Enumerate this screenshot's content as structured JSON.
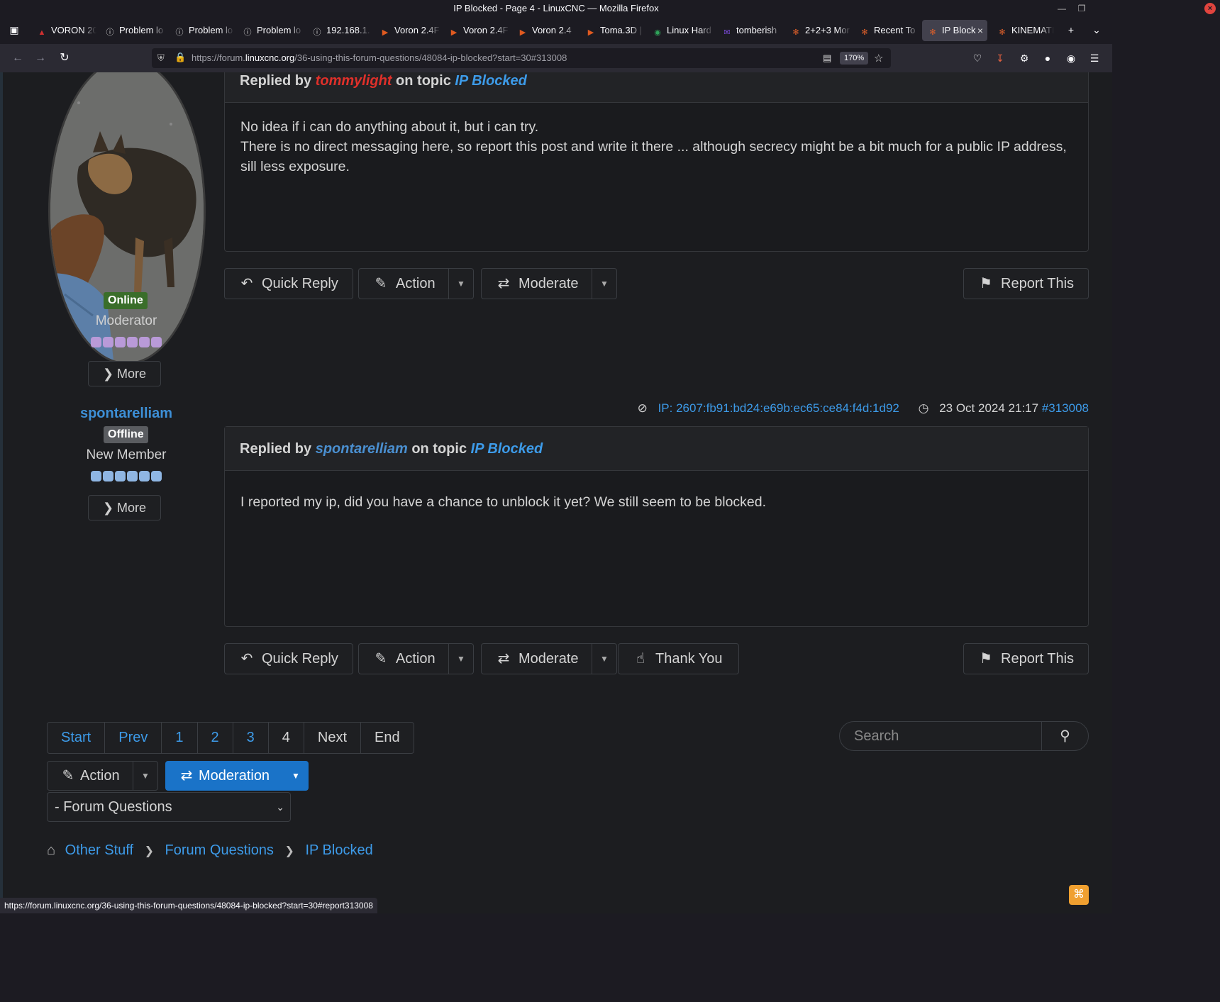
{
  "window": {
    "title": "IP Blocked - Page 4 - LinuxCNC — Mozilla Firefox"
  },
  "tabs": [
    {
      "label": "VORON 20",
      "icon": "voron-icon"
    },
    {
      "label": "Problem lo",
      "icon": "info-icon"
    },
    {
      "label": "Problem lo",
      "icon": "info-icon"
    },
    {
      "label": "Problem lo",
      "icon": "info-icon"
    },
    {
      "label": "192.168.1.",
      "icon": "info-icon"
    },
    {
      "label": "Voron 2.4F",
      "icon": "bookmark-icon"
    },
    {
      "label": "Voron 2.4F",
      "icon": "bookmark-icon"
    },
    {
      "label": "Voron 2.4",
      "icon": "bookmark-icon"
    },
    {
      "label": "Toma.3D |",
      "icon": "bookmark-icon"
    },
    {
      "label": "Linux Hard",
      "icon": "chat-icon"
    },
    {
      "label": "tomberish",
      "icon": "mail-icon"
    },
    {
      "label": "2+2+3 Mor",
      "icon": "joomla-icon"
    },
    {
      "label": "Recent To",
      "icon": "joomla-icon"
    },
    {
      "label": "IP Block",
      "icon": "joomla-icon"
    },
    {
      "label": "KINEMATIC",
      "icon": "joomla-icon"
    }
  ],
  "url": {
    "prefix": "https://forum.",
    "domain": "linuxcnc.org",
    "path": "/36-using-this-forum-questions/48084-ip-blocked?start=30#313008",
    "zoom": "170%"
  },
  "post1": {
    "head_prefix": "Replied by",
    "user": "tommylight",
    "head_mid": "on topic",
    "topic": "IP Blocked",
    "body_line1": "No idea if i can do anything about it, but i can try.",
    "body_line2": "There is no direct messaging here, so report this post and write it there ... although secrecy might be a bit much for a public IP address, sill less exposure."
  },
  "user1": {
    "status": "Online",
    "role": "Moderator",
    "more": "More",
    "status_color": "#3a6e2a",
    "dot_color": "#b99ad8"
  },
  "user2": {
    "name": "spontarelliam",
    "status": "Offline",
    "role": "New Member",
    "more": "More",
    "status_color": "#5a5c60",
    "dot_color": "#8fb6e3"
  },
  "post2": {
    "ip": "IP: 2607:fb91:bd24:e69b:ec65:ce84:f4d:1d92",
    "date": "23 Oct 2024 21:17",
    "permalink": "#313008",
    "head_prefix": "Replied by",
    "user": "spontarelliam",
    "head_mid": "on topic",
    "topic": "IP Blocked",
    "body": "I reported my ip, did you have a chance to unblock it yet? We still seem to be blocked."
  },
  "buttons": {
    "quick_reply": "Quick Reply",
    "action": "Action",
    "moderate": "Moderate",
    "report": "Report This",
    "thank_you": "Thank You"
  },
  "pager": [
    "Start",
    "Prev",
    "1",
    "2",
    "3",
    "4",
    "Next",
    "End"
  ],
  "search": {
    "placeholder": "Search"
  },
  "bottom": {
    "action": "Action",
    "moderation": "Moderation",
    "forum_select": "- Forum Questions"
  },
  "breadcrumb": [
    "Other Stuff",
    "Forum Questions",
    "IP Blocked"
  ],
  "status_url": "https://forum.linuxcnc.org/36-using-this-forum-questions/48084-ip-blocked?start=30#report313008",
  "colors": {
    "accent": "#3d9be9",
    "moderation_btn": "#1a73c8",
    "mod_username": "#e0302a"
  }
}
